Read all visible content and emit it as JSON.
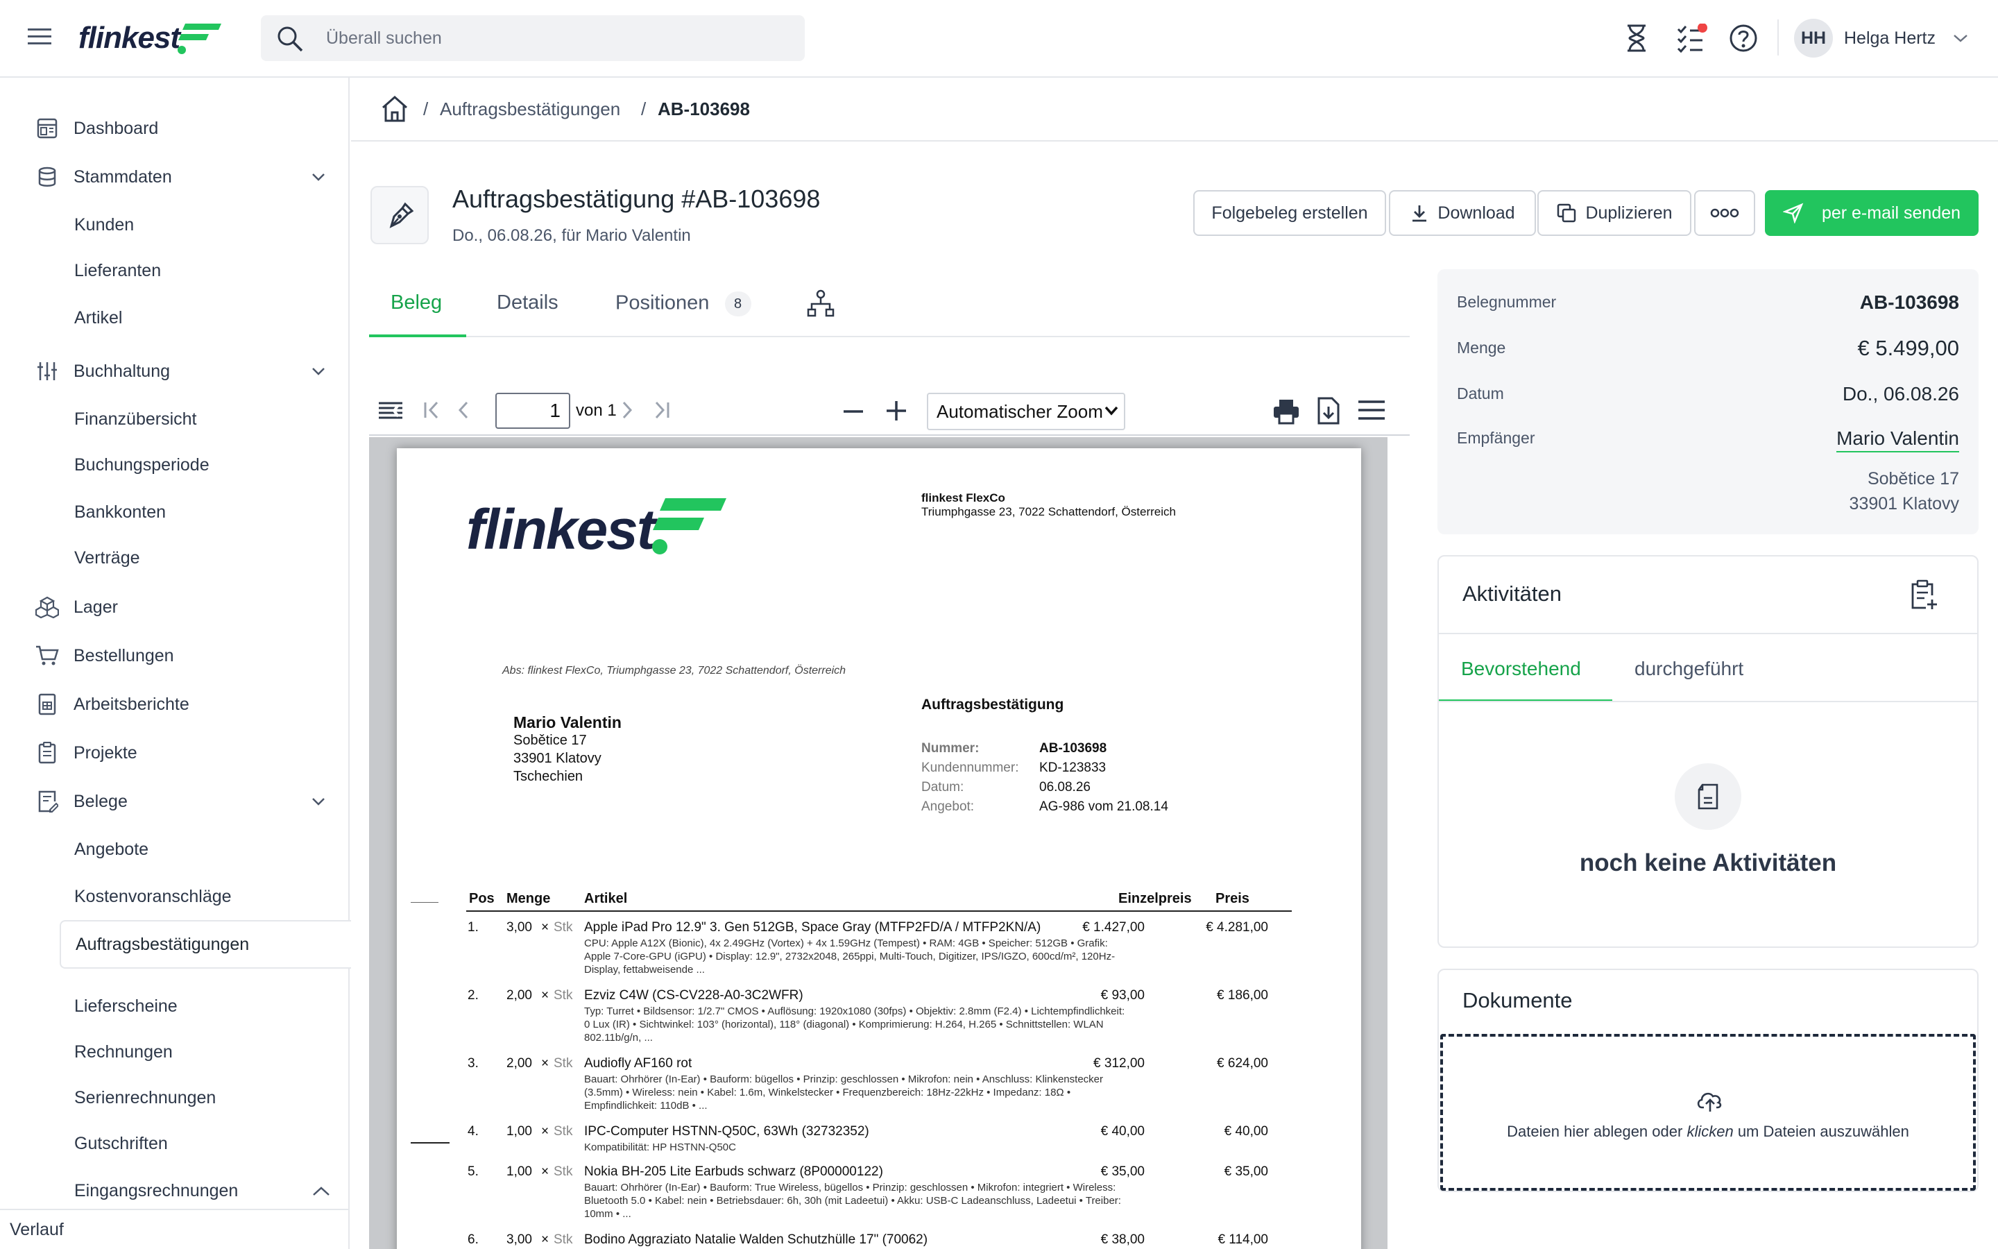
{
  "header": {
    "logo_text": "flinkest",
    "search_placeholder": "Überall suchen",
    "user_initials": "HH",
    "user_name": "Helga Hertz",
    "brand_color": "#22c55e",
    "logo_color": "#1a2341"
  },
  "sidebar": {
    "dashboard": "Dashboard",
    "stammdaten": "Stammdaten",
    "kunden": "Kunden",
    "lieferanten": "Lieferanten",
    "artikel": "Artikel",
    "buchhaltung": "Buchhaltung",
    "finanzuebersicht": "Finanzübersicht",
    "buchungsperiode": "Buchungsperiode",
    "bankkonten": "Bankkonten",
    "vertraege": "Verträge",
    "lager": "Lager",
    "bestellungen": "Bestellungen",
    "arbeitsberichte": "Arbeitsberichte",
    "projekte": "Projekte",
    "belege": "Belege",
    "angebote": "Angebote",
    "kostenvoranschlaege": "Kostenvoranschläge",
    "auftragsbestaetigungen": "Auftragsbestätigungen",
    "lieferscheine": "Lieferscheine",
    "rechnungen": "Rechnungen",
    "serienrechnungen": "Serienrechnungen",
    "gutschriften": "Gutschriften",
    "eingangsrechnungen": "Eingangsrechnungen",
    "verlauf": "Verlauf"
  },
  "breadcrumb": {
    "sep": "/",
    "level1": "Auftragsbestätigungen",
    "level2": "AB-103698"
  },
  "doc": {
    "title": "Auftragsbestätigung #AB-103698",
    "subtitle": "Do., 06.08.26, für Mario Valentin",
    "btn_folgebeleg": "Folgebeleg erstellen",
    "btn_download": "Download",
    "btn_duplizieren": "Duplizieren",
    "btn_send": "per e-mail senden"
  },
  "tabs": {
    "beleg": "Beleg",
    "details": "Details",
    "positionen": "Positionen",
    "positionen_count": "8"
  },
  "viewer": {
    "page": "1",
    "of": "von 1",
    "zoom": "Automatischer Zoom"
  },
  "pdf": {
    "company_name": "flinkest FlexCo",
    "company_address": "Triumphgasse 23, 7022 Schattendorf, Österreich",
    "sender_line": "Abs: flinkest FlexCo, Triumphgasse 23, 7022 Schattendorf, Österreich",
    "recipient_name": "Mario Valentin",
    "recipient_street": "Sobětice 17",
    "recipient_city": "33901 Klatovy",
    "recipient_country": "Tschechien",
    "doc_type": "Auftragsbestätigung",
    "meta": [
      {
        "label": "Nummer:",
        "value": "AB-103698"
      },
      {
        "label": "Kundennummer:",
        "value": "KD-123833"
      },
      {
        "label": "Datum:",
        "value": "06.08.26"
      },
      {
        "label": "Angebot:",
        "value": "AG-986 vom 21.08.14"
      }
    ],
    "col_pos": "Pos",
    "col_menge": "Menge",
    "col_artikel": "Artikel",
    "col_einzelpreis": "Einzelpreis",
    "col_preis": "Preis",
    "unit": "Stk",
    "times": "×",
    "items": [
      {
        "pos": "1.",
        "qty": "3,00",
        "name": "Apple iPad Pro 12.9\" 3. Gen 512GB, Space Gray (MTFP2FD/A / MTFP2KN/A)",
        "desc": "CPU: Apple A12X (Bionic), 4x 2.49GHz (Vortex) + 4x 1.59GHz (Tempest) • RAM: 4GB • Speicher: 512GB • Grafik: Apple 7-Core-GPU (iGPU) • Display: 12.9\", 2732x2048, 265ppi, Multi-Touch, Digitizer, IPS/IGZO, 600cd/m², 120Hz-Display, fettabweisende ...",
        "unit_price": "€ 1.427,00",
        "price": "€ 4.281,00"
      },
      {
        "pos": "2.",
        "qty": "2,00",
        "name": "Ezviz C4W (CS-CV228-A0-3C2WFR)",
        "desc": "Typ: Turret • Bildsensor: 1/2.7\" CMOS • Auflösung: 1920x1080 (30fps) • Objektiv: 2.8mm (F2.4) • Lichtempfindlichkeit: 0 Lux (IR) • Sichtwinkel: 103° (horizontal), 118° (diagonal) • Komprimierung: H.264, H.265 • Schnittstellen: WLAN 802.11b/g/n, ...",
        "unit_price": "€ 93,00",
        "price": "€ 186,00"
      },
      {
        "pos": "3.",
        "qty": "2,00",
        "name": "Audiofly AF160 rot",
        "desc": "Bauart: Ohrhörer (In-Ear) • Bauform: bügellos • Prinzip: geschlossen • Mikrofon: nein • Anschluss: Klinkenstecker (3.5mm) • Wireless: nein • Kabel: 1.6m, Winkelstecker • Frequenzbereich: 18Hz-22kHz • Impedanz: 18Ω • Empfindlichkeit: 110dB • ...",
        "unit_price": "€ 312,00",
        "price": "€ 624,00"
      },
      {
        "pos": "4.",
        "qty": "1,00",
        "name": "IPC-Computer HSTNN-Q50C, 63Wh (32732352)",
        "desc": "Kompatibilität: HP HSTNN-Q50C",
        "unit_price": "€ 40,00",
        "price": "€ 40,00"
      },
      {
        "pos": "5.",
        "qty": "1,00",
        "name": "Nokia BH-205 Lite Earbuds schwarz (8P00000122)",
        "desc": "Bauart: Ohrhörer (In-Ear) • Bauform: True Wireless, bügellos • Prinzip: geschlossen • Mikrofon: integriert • Wireless: Bluetooth 5.0 • Kabel: nein • Betriebsdauer: 6h, 30h (mit Ladeetui) • Akku: USB-C Ladeanschluss, Ladeetui • Treiber: 10mm • ...",
        "unit_price": "€ 35,00",
        "price": "€ 35,00"
      },
      {
        "pos": "6.",
        "qty": "3,00",
        "name": "Bodino Aggraziato Natalie Walden Schutzhülle 17\" (70062)",
        "desc": "",
        "unit_price": "€ 38,00",
        "price": "€ 114,00"
      }
    ]
  },
  "info": {
    "belegnummer_label": "Belegnummer",
    "belegnummer": "AB-103698",
    "menge_label": "Menge",
    "menge": "€ 5.499,00",
    "datum_label": "Datum",
    "datum": "Do., 06.08.26",
    "empfaenger_label": "Empfänger",
    "empfaenger": "Mario Valentin",
    "street": "Sobětice 17",
    "city": "33901 Klatovy"
  },
  "activities": {
    "title": "Aktivitäten",
    "tab_upcoming": "Bevorstehend",
    "tab_done": "durchgeführt",
    "empty": "noch keine Aktivitäten"
  },
  "documents": {
    "title": "Dokumente",
    "drop_pre": "Dateien hier ablegen oder",
    "drop_em": "klicken",
    "drop_post": "um Dateien auszuwählen"
  }
}
